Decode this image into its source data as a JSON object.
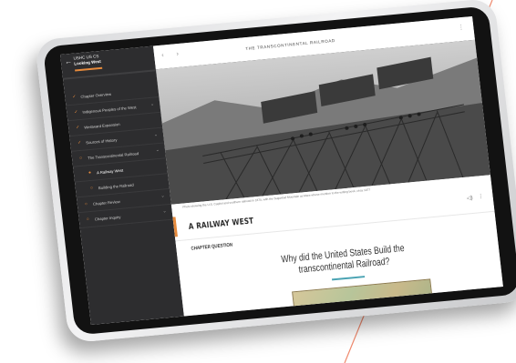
{
  "sidebar": {
    "course": "USHC US CS",
    "unit_title": "Looking West",
    "items": [
      {
        "label": "Chapter Overview",
        "icon": "check-icon",
        "indent": 0,
        "chevron": false
      },
      {
        "label": "Indigenous Peoples of the West",
        "icon": "check-icon",
        "indent": 0,
        "chevron": true
      },
      {
        "label": "Westward Expansion",
        "icon": "check-icon",
        "indent": 0,
        "chevron": false
      },
      {
        "label": "Sources of History",
        "icon": "check-icon",
        "indent": 0,
        "chevron": true
      },
      {
        "label": "The Transcontinental Railroad",
        "icon": "circle-icon",
        "indent": 0,
        "chevron": true
      },
      {
        "label": "A Railway West",
        "icon": "dot-icon",
        "indent": 1,
        "chevron": false,
        "active": true
      },
      {
        "label": "Building the Railroad",
        "icon": "circle-icon",
        "indent": 1,
        "chevron": false
      },
      {
        "label": "Chapter Review",
        "icon": "circle-icon",
        "indent": 0,
        "chevron": true
      },
      {
        "label": "Chapter Inquiry",
        "icon": "circle-icon",
        "indent": 0,
        "chevron": true
      }
    ]
  },
  "topbar": {
    "prev_label": "‹",
    "next_label": "›",
    "title": "THE TRANSCONTINENTAL RAILROAD",
    "more_label": "⋮"
  },
  "photo": {
    "caption": "Photo showing the U.S. Capitol and southern railroad in 1870, with the Sugarloaf Mountain as Mare whose mention to the writing book, circa 1877"
  },
  "content": {
    "section_title": "A RAILWAY WEST",
    "audio_label": "◁)",
    "more_label": "⋮",
    "chapter_question_label": "CHAPTER QUESTION",
    "question": "Why did the United States Build the transcontinental Railroad?"
  },
  "colors": {
    "accent": "#e58a3c",
    "teal": "#4aa3b3",
    "sidebar_bg": "#2d2d2f"
  }
}
